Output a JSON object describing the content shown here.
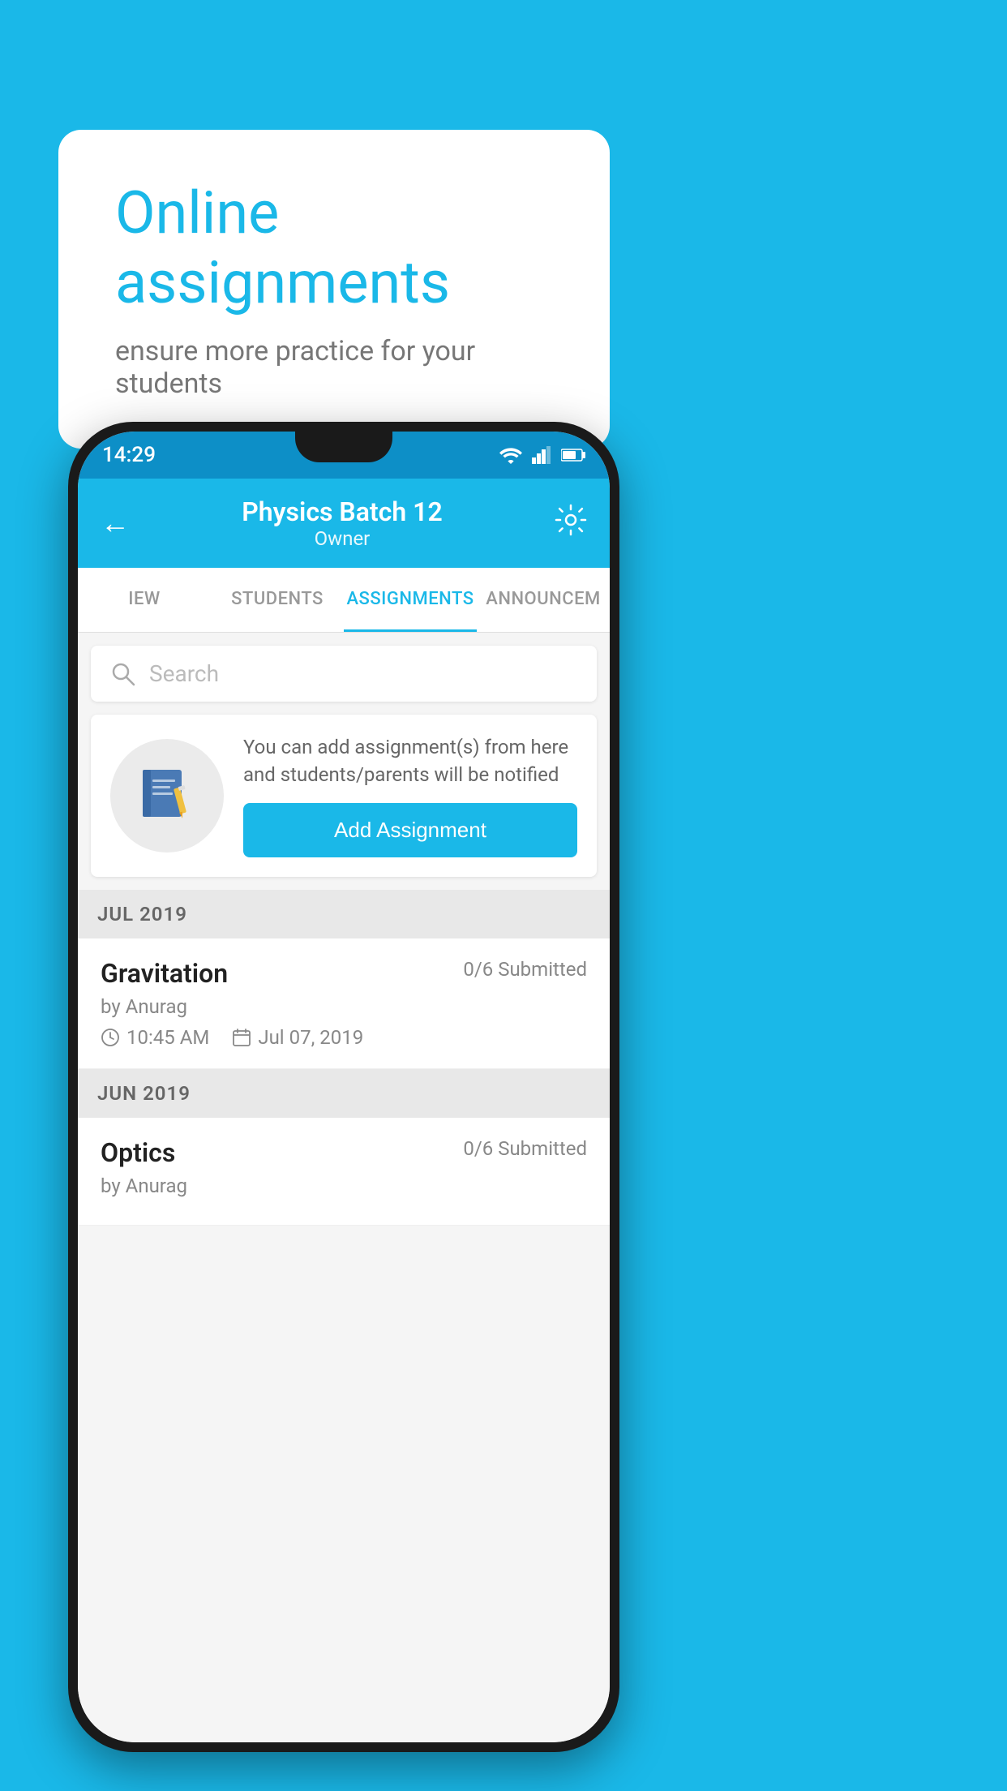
{
  "background_color": "#1ab8e8",
  "speech_bubble": {
    "title": "Online assignments",
    "subtitle": "ensure more practice for your students"
  },
  "phone": {
    "status_bar": {
      "time": "14:29",
      "icons": [
        "wifi",
        "signal",
        "battery"
      ]
    },
    "header": {
      "back_label": "←",
      "title": "Physics Batch 12",
      "subtitle": "Owner",
      "settings_label": "⚙"
    },
    "tabs": [
      {
        "label": "IEW",
        "active": false
      },
      {
        "label": "STUDENTS",
        "active": false
      },
      {
        "label": "ASSIGNMENTS",
        "active": true
      },
      {
        "label": "ANNOUNCEM",
        "active": false
      }
    ],
    "search": {
      "placeholder": "Search"
    },
    "promo_card": {
      "icon": "📓",
      "text": "You can add assignment(s) from here and students/parents will be notified",
      "button_label": "Add Assignment"
    },
    "sections": [
      {
        "month_label": "JUL 2019",
        "assignments": [
          {
            "title": "Gravitation",
            "status": "0/6 Submitted",
            "author": "by Anurag",
            "time": "10:45 AM",
            "date": "Jul 07, 2019"
          }
        ]
      },
      {
        "month_label": "JUN 2019",
        "assignments": [
          {
            "title": "Optics",
            "status": "0/6 Submitted",
            "author": "by Anurag",
            "time": "",
            "date": ""
          }
        ]
      }
    ]
  }
}
